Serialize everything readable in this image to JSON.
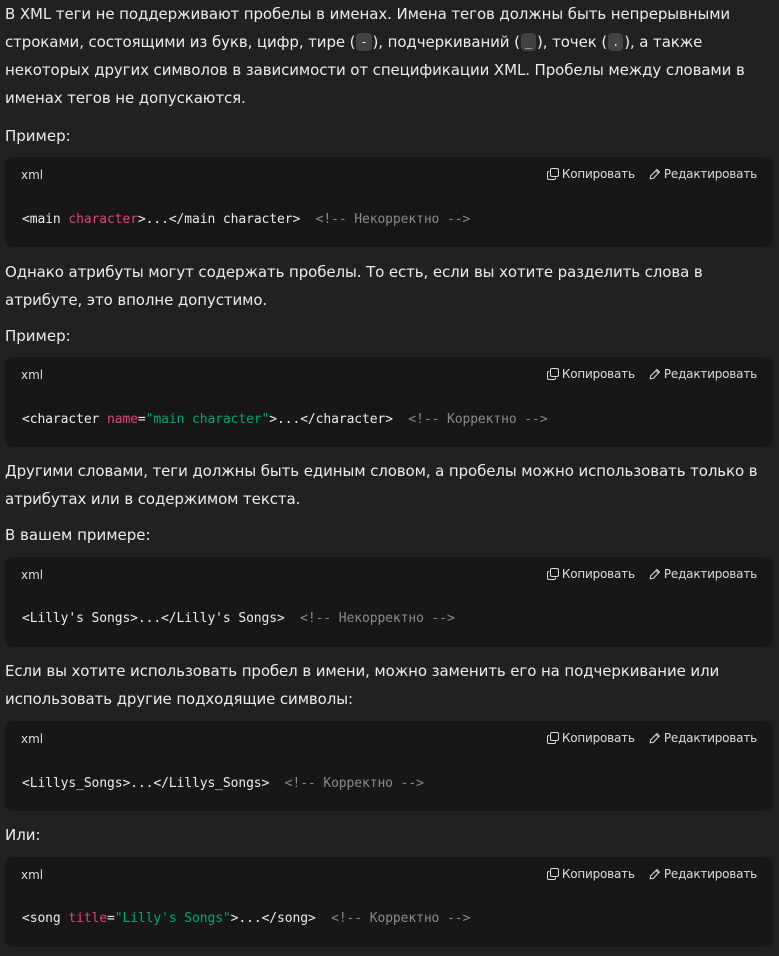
{
  "intro": {
    "part1": "В XML теги не поддерживают пробелы в именах. Имена тегов должны быть непрерывными строками, состоящими из букв, цифр, тире (",
    "dash": "-",
    "part2": "), подчеркиваний (",
    "underscore": "_",
    "part3": "), точек (",
    "dot": ".",
    "part4": "), а также некоторых других символов в зависимости от спецификации XML. Пробелы между словами в именах тегов не допускаются."
  },
  "example_label_1": "Пример:",
  "code_blocks": [
    {
      "lang": "xml",
      "copy_label": "Копировать",
      "edit_label": "Редактировать",
      "parts": {
        "a": "<main ",
        "attr": "character",
        "b": ">...</main character>  ",
        "comment": "<!-- Некорректно -->"
      }
    },
    {
      "lang": "xml",
      "copy_label": "Копировать",
      "edit_label": "Редактировать",
      "parts": {
        "a": "<character ",
        "attr": "name",
        "eq": "=",
        "str": "\"main character\"",
        "b": ">...</character>  ",
        "comment": "<!-- Корректно -->"
      }
    },
    {
      "lang": "xml",
      "copy_label": "Копировать",
      "edit_label": "Редактировать",
      "parts": {
        "a": "<Lilly's Songs>...</Lilly's Songs>  ",
        "comment": "<!-- Некорректно -->"
      }
    },
    {
      "lang": "xml",
      "copy_label": "Копировать",
      "edit_label": "Редактировать",
      "parts": {
        "a": "<Lillys_Songs>...</Lillys_Songs>  ",
        "comment": "<!-- Корректно -->"
      }
    },
    {
      "lang": "xml",
      "copy_label": "Копировать",
      "edit_label": "Редактировать",
      "parts": {
        "a": "<song ",
        "attr": "title",
        "eq": "=",
        "str": "\"Lilly's Songs\"",
        "b": ">...</song>  ",
        "comment": "<!-- Корректно -->"
      }
    }
  ],
  "para_attributes": "Однако атрибуты могут содержать пробелы. То есть, если вы хотите разделить слова в атрибуте, это вполне допустимо.",
  "example_label_2": "Пример:",
  "para_summary": "Другими словами, теги должны быть единым словом, а пробелы можно использовать только в атрибутах или в содержимом текста.",
  "your_example_label": "В вашем примере:",
  "para_replace": "Если вы хотите использовать пробел в имени, можно заменить его на подчеркивание или использовать другие подходящие символы:",
  "or_label": "Или:",
  "colors": {
    "background": "#212121",
    "code_background": "#171717",
    "attribute": "#e0447a",
    "string": "#00a67d",
    "comment": "#8a8a8a"
  },
  "icons": {
    "copy": "copy-icon",
    "edit": "pencil-icon"
  }
}
